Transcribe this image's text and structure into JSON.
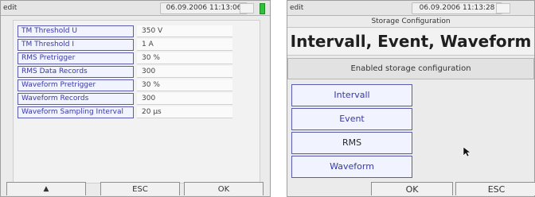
{
  "left": {
    "titlebar": {
      "mode": "edit",
      "datetime": "06.09.2006 11:13:06"
    },
    "settings": [
      {
        "label": "TM Threshold U",
        "value": "350 V"
      },
      {
        "label": "TM Threshold I",
        "value": "1 A"
      },
      {
        "label": "RMS Pretrigger",
        "value": "30 %"
      },
      {
        "label": "RMS Data Records",
        "value": "300"
      },
      {
        "label": "Waveform Pretrigger",
        "value": "30 %"
      },
      {
        "label": "Waveform Records",
        "value": "300"
      },
      {
        "label": "Waveform Sampling Interval",
        "value": "20 µs"
      }
    ],
    "bottom": {
      "up_label": "▲",
      "esc_label": "ESC",
      "ok_label": "OK"
    }
  },
  "right": {
    "titlebar": {
      "mode": "edit",
      "datetime": "06.09.2006 11:13:28"
    },
    "subtitle": "Storage Configuration",
    "title": "Intervall, Event, Waveform",
    "enabled_text": "Enabled storage configuration",
    "options": [
      {
        "label": "Intervall"
      },
      {
        "label": "Event"
      },
      {
        "label": "RMS"
      },
      {
        "label": "Waveform"
      }
    ],
    "bottom": {
      "ok_label": "OK",
      "esc_label": "ESC"
    }
  },
  "colors": {
    "button_text": "#3838a6",
    "button_border": "#5a5ab0",
    "battery": "#2ec23a"
  }
}
